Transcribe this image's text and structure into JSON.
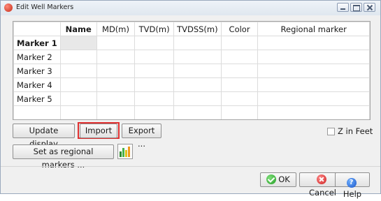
{
  "window": {
    "title": "Edit Well Markers"
  },
  "table": {
    "columns": [
      "",
      "Name",
      "MD(m)",
      "TVD(m)",
      "TVDSS(m)",
      "Color",
      "Regional marker"
    ],
    "rows": [
      {
        "label": "Marker 1",
        "cells": [
          "",
          "",
          "",
          "",
          "",
          ""
        ]
      },
      {
        "label": "Marker 2",
        "cells": [
          "",
          "",
          "",
          "",
          "",
          ""
        ]
      },
      {
        "label": "Marker 3",
        "cells": [
          "",
          "",
          "",
          "",
          "",
          ""
        ]
      },
      {
        "label": "Marker 4",
        "cells": [
          "",
          "",
          "",
          "",
          "",
          ""
        ]
      },
      {
        "label": "Marker 5",
        "cells": [
          "",
          "",
          "",
          "",
          "",
          ""
        ]
      }
    ]
  },
  "buttons": {
    "update_display": "Update display",
    "import": "Import ...",
    "export": "Export ...",
    "set_regional": "Set as regional markers ...",
    "ok": "OK",
    "cancel": "Cancel",
    "help": "Help"
  },
  "z_in_feet": {
    "label": "Z in Feet",
    "checked": false
  },
  "icons": {
    "app": "app-icon",
    "color_chart": "color-bars-icon",
    "ok": "ok-check-icon",
    "cancel": "cancel-x-icon",
    "help": "help-icon"
  },
  "colors": {
    "highlight": "#e03030",
    "ok_green": "#219b22",
    "cancel_red": "#cc1f1f",
    "help_blue": "#1a55c8"
  }
}
